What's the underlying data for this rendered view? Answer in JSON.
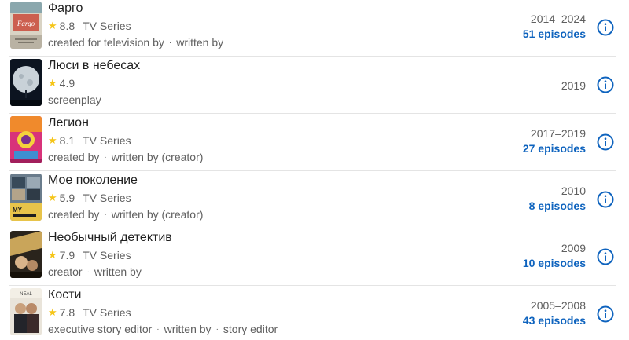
{
  "colors": {
    "accent": "#0e63be",
    "star": "#f5c518",
    "muted": "#5f5f5f",
    "divider": "#e4e4e4"
  },
  "items": [
    {
      "title": "Фарго",
      "rating": "8.8",
      "kind": "TV Series",
      "credits": [
        "created for television by",
        "written by"
      ],
      "years": "2014–2024",
      "episodes": "51 episodes",
      "poster_icon": "fargo-poster"
    },
    {
      "title": "Люси в небесах",
      "rating": "4.9",
      "kind": "",
      "credits": [
        "screenplay"
      ],
      "years": "2019",
      "episodes": "",
      "poster_icon": "lucy-in-the-sky-poster"
    },
    {
      "title": "Легион",
      "rating": "8.1",
      "kind": "TV Series",
      "credits": [
        "created by",
        "written by (creator)"
      ],
      "years": "2017–2019",
      "episodes": "27 episodes",
      "poster_icon": "legion-poster"
    },
    {
      "title": "Мое поколение",
      "rating": "5.9",
      "kind": "TV Series",
      "credits": [
        "created by",
        "written by (creator)"
      ],
      "years": "2010",
      "episodes": "8 episodes",
      "poster_icon": "my-generation-poster"
    },
    {
      "title": "Необычный детектив",
      "rating": "7.9",
      "kind": "TV Series",
      "credits": [
        "creator",
        "written by"
      ],
      "years": "2009",
      "episodes": "10 episodes",
      "poster_icon": "unusual-detective-poster"
    },
    {
      "title": "Кости",
      "rating": "7.8",
      "kind": "TV Series",
      "credits": [
        "executive story editor",
        "written by",
        "story editor"
      ],
      "years": "2005–2008",
      "episodes": "43 episodes",
      "poster_icon": "bones-poster"
    }
  ]
}
